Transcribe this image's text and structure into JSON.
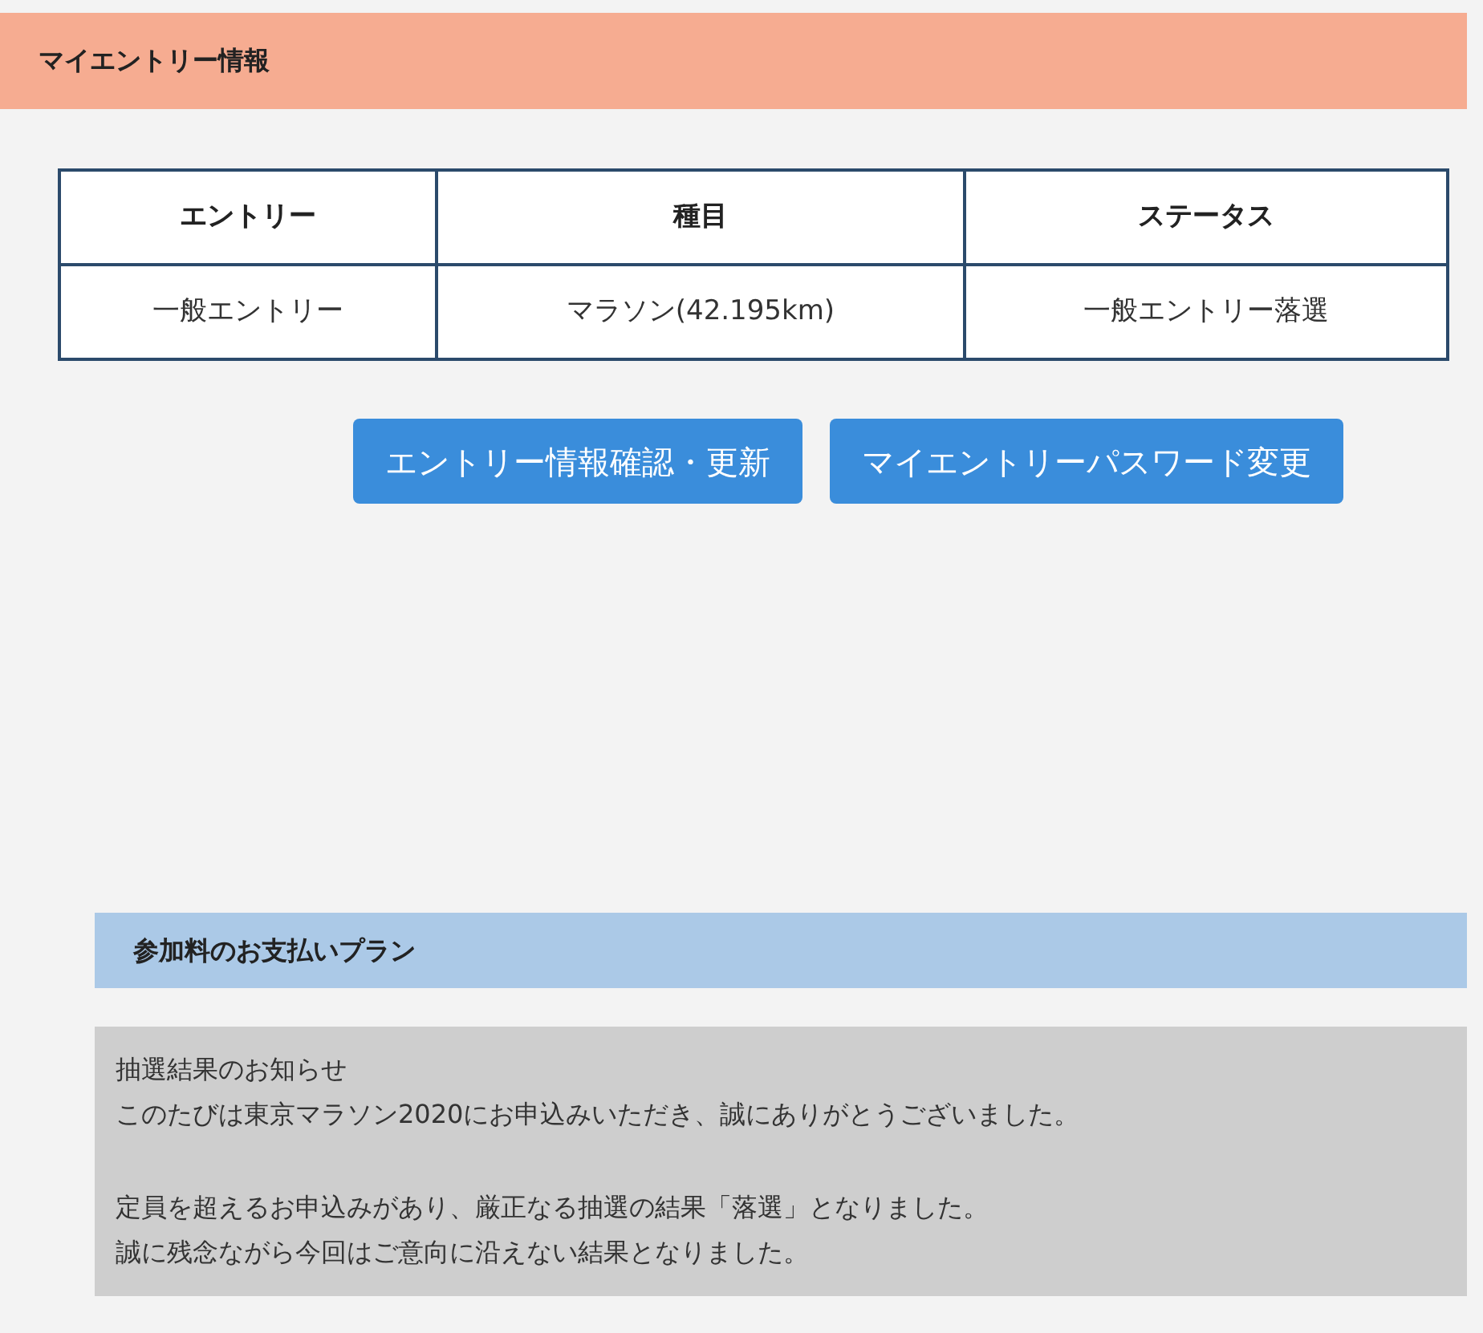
{
  "entry_section": {
    "title": "マイエントリー情報",
    "table": {
      "columns": [
        "エントリー",
        "種目",
        "ステータス"
      ],
      "rows": [
        [
          "一般エントリー",
          "マラソン(42.195km)",
          "一般エントリー落選"
        ]
      ]
    },
    "buttons": [
      "エントリー情報確認・更新",
      "マイエントリーパスワード変更"
    ]
  },
  "payment_section": {
    "title": "参加料のお支払いプラン",
    "notice": {
      "paragraphs": [
        [
          "抽選結果のお知らせ",
          "このたびは東京マラソン2020にお申込みいただき、誠にありがとうございました。"
        ],
        [
          "定員を超えるお申込みがあり、厳正なる抽選の結果「落選」となりました。",
          "誠に残念ながら今回はご意向に沿えない結果となりました。"
        ]
      ]
    }
  }
}
